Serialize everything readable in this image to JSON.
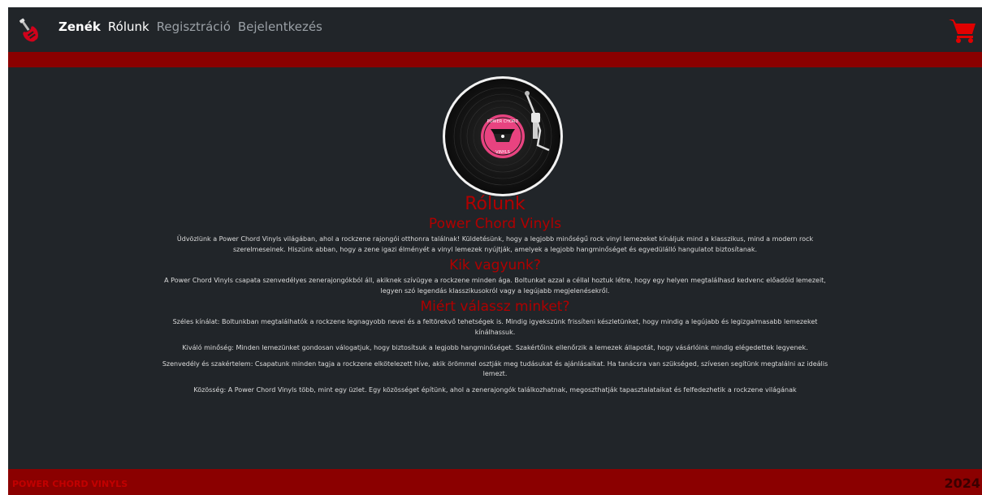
{
  "nav": {
    "links": [
      {
        "label": "Zenék",
        "state": "active"
      },
      {
        "label": "Rólunk",
        "state": "normal"
      },
      {
        "label": "Regisztráció",
        "state": "muted"
      },
      {
        "label": "Bejelentkezés",
        "state": "muted"
      }
    ],
    "logo_icon": "electric-guitar-icon",
    "cart_icon": "shopping-cart-icon"
  },
  "vinyl": {
    "label_top": "POWER CHORD",
    "label_bottom": "VINYLS"
  },
  "about": {
    "title": "Rólunk",
    "sections": [
      {
        "heading": "Power Chord Vinyls",
        "paragraphs": [
          "Üdvözlünk a Power Chord Vinyls világában, ahol a rockzene rajongói otthonra találnak! Küldetésünk, hogy a legjobb minőségű rock vinyl lemezeket kínáljuk mind a klasszikus, mind a modern rock szerelmeseinek. Hiszünk abban, hogy a zene igazi élményét a vinyl lemezek nyújtják, amelyek a legjobb hangminőséget és egyedülálló hangulatot biztosítanak."
        ]
      },
      {
        "heading": "Kik vagyunk?",
        "paragraphs": [
          "A Power Chord Vinyls csapata szenvedélyes zenerajongókból áll, akiknek szívügye a rockzene minden ága. Boltunkat azzal a céllal hoztuk létre, hogy egy helyen megtalálhasd kedvenc előadóid lemezeit, legyen szó legendás klasszikusokról vagy a legújabb megjelenésekről."
        ]
      },
      {
        "heading": "Miért válassz minket?",
        "paragraphs": [
          "Széles kínálat: Boltunkban megtalálhatók a rockzene legnagyobb nevei és a feltörekvő tehetségek is. Mindig igyekszünk frissíteni készletünket, hogy mindig a legújabb és legizgalmasabb lemezeket kínálhassuk.",
          "Kiváló minőség: Minden lemezünket gondosan válogatjuk, hogy biztosítsuk a legjobb hangminőséget. Szakértőink ellenőrzik a lemezek állapotát, hogy vásárlóink mindig elégedettek legyenek.",
          "Szenvedély és szakértelem: Csapatunk minden tagja a rockzene elkötelezett híve, akik örömmel osztják meg tudásukat és ajánlásaikat. Ha tanácsra van szükséged, szívesen segítünk megtalálni az ideális lemezt.",
          "Közösség: A Power Chord Vinyls több, mint egy üzlet. Egy közösséget építünk, ahol a zenerajongók találkozhatnak, megoszthatják tapasztalataikat és felfedezhetik a rockzene világának"
        ]
      }
    ]
  },
  "footer": {
    "brand": "POWER CHORD VINYLS",
    "year": "2024"
  },
  "colors": {
    "background": "#212529",
    "accent_red": "#8b0000",
    "heading_red": "#b00000"
  }
}
